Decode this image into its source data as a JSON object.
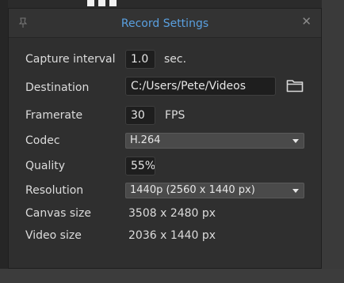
{
  "dialog": {
    "title": "Record Settings",
    "close_glyph": "✕",
    "pin_icon": "pin-icon",
    "accent": "#5aa0e0"
  },
  "fields": {
    "capture_interval": {
      "label": "Capture interval",
      "value": "1.0",
      "unit": "sec."
    },
    "destination": {
      "label": "Destination",
      "value": "C:/Users/Pete/Videos",
      "icon": "folder-icon"
    },
    "framerate": {
      "label": "Framerate",
      "value": "30",
      "unit": "FPS"
    },
    "codec": {
      "label": "Codec",
      "value": "H.264"
    },
    "quality": {
      "label": "Quality",
      "value": "55%"
    },
    "resolution": {
      "label": "Resolution",
      "value": "1440p (2560 x 1440 px)"
    },
    "canvas_size": {
      "label": "Canvas size",
      "value": "3508 x 2480 px"
    },
    "video_size": {
      "label": "Video size",
      "value": "2036 x 1440 px"
    }
  }
}
